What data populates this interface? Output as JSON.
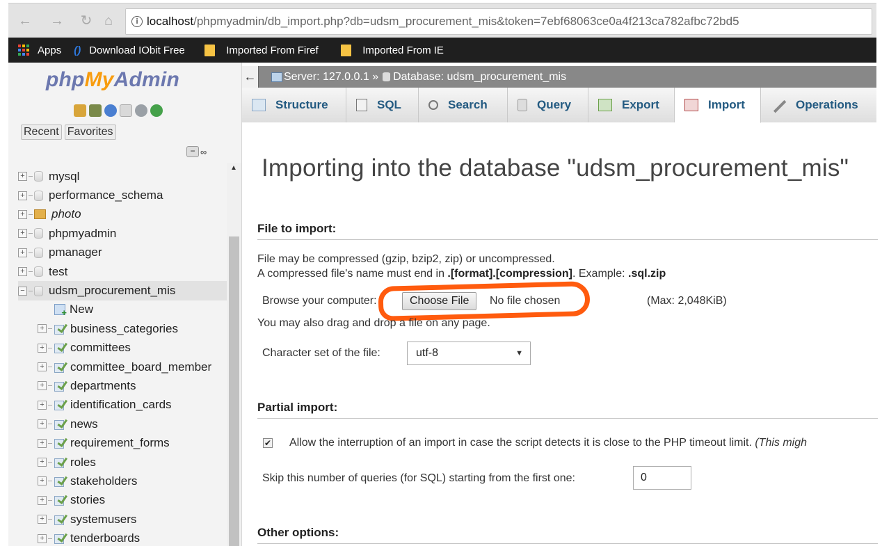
{
  "browser": {
    "url_host": "localhost",
    "url_rest": "/phpmyadmin/db_import.php?db=udsm_procurement_mis&token=7ebf68063ce0a4f213ca782afbc72bd5",
    "nav_icons": [
      "back-icon",
      "forward-icon",
      "reload-icon",
      "home-icon"
    ],
    "bookmarks": [
      {
        "label": "Apps",
        "icon": "apps-icon"
      },
      {
        "label": "Download IObit Free",
        "icon": "iobit-icon"
      },
      {
        "label": "Imported From Firef",
        "icon": "folder-icon"
      },
      {
        "label": "Imported From IE",
        "icon": "folder-icon"
      }
    ]
  },
  "sidebar": {
    "logo_php": "php",
    "logo_my": "My",
    "logo_admin": "Admin",
    "recent_label": "Recent",
    "favorites_label": "Favorites",
    "databases": [
      {
        "label": "mysql"
      },
      {
        "label": "performance_schema"
      },
      {
        "label": "photo"
      },
      {
        "label": "phpmyadmin"
      },
      {
        "label": "pmanager"
      },
      {
        "label": "test"
      },
      {
        "label": "udsm_procurement_mis"
      }
    ],
    "new_label": "New",
    "tables": [
      "business_categories",
      "committees",
      "committee_board_member",
      "departments",
      "identification_cards",
      "news",
      "requirement_forms",
      "roles",
      "stakeholders",
      "stories",
      "systemusers",
      "tenderboards"
    ]
  },
  "breadcrumb": {
    "server": "Server: 127.0.0.1 »",
    "database": "Database: udsm_procurement_mis"
  },
  "tabs": [
    {
      "label": "Structure",
      "icon": "structure-icon",
      "active": false
    },
    {
      "label": "SQL",
      "icon": "sql-icon",
      "active": false
    },
    {
      "label": "Search",
      "icon": "search-icon",
      "active": false
    },
    {
      "label": "Query",
      "icon": "query-icon",
      "active": false
    },
    {
      "label": "Export",
      "icon": "export-icon",
      "active": false
    },
    {
      "label": "Import",
      "icon": "import-icon",
      "active": true
    },
    {
      "label": "Operations",
      "icon": "wrench-icon",
      "active": false
    }
  ],
  "main": {
    "title": "Importing into the database \"udsm_procurement_mis\"",
    "file_section": "File to import:",
    "compress_note": "File may be compressed (gzip, bzip2, zip) or uncompressed.",
    "compress_note2_pre": "A compressed file's name must end in ",
    "compress_note2_format": ".[format].[compression]",
    "compress_note2_mid": ". Example: ",
    "compress_note2_example": ".sql.zip",
    "browse_label": "Browse your computer:",
    "choose_file": "Choose File",
    "no_file": "No file chosen",
    "max_size": "(Max: 2,048KiB)",
    "drag_note": "You may also drag and drop a file on any page.",
    "charset_label": "Character set of the file:",
    "charset_value": "utf-8",
    "partial_section": "Partial import:",
    "allow_interrupt": "Allow the interruption of an import in case the script detects it is close to the PHP timeout limit.",
    "allow_interrupt_tail": "(This migh",
    "allow_interrupt_checked": true,
    "skip_label": "Skip this number of queries (for SQL) starting from the first one:",
    "skip_value": "0",
    "other_section": "Other options:"
  },
  "colors": {
    "annotation": "#ff5b0e",
    "tab_text": "#235a81",
    "logo_blue": "#6c78af",
    "logo_orange": "#f89c0e"
  }
}
